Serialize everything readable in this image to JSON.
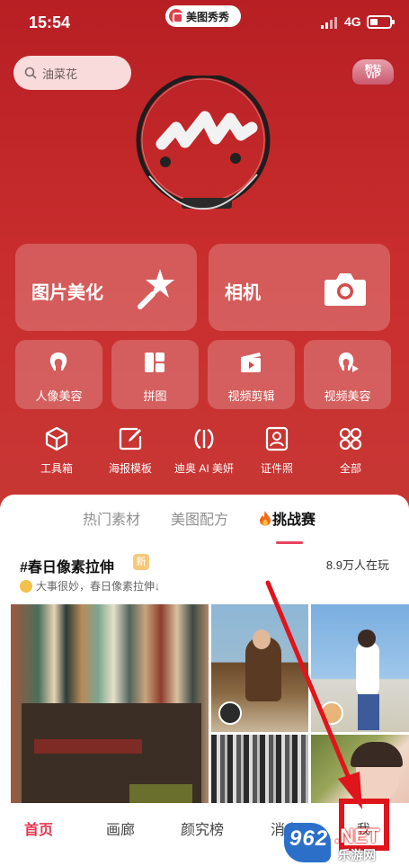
{
  "status_bar": {
    "time": "15:54",
    "network": "4G",
    "app_pill": "美图秀秀"
  },
  "search": {
    "placeholder": "油菜花"
  },
  "vip": {
    "line1": "粉钻",
    "line2": "VIP"
  },
  "main_cards": [
    {
      "label": "图片美化",
      "icon": "magic-wand-icon"
    },
    {
      "label": "相机",
      "icon": "camera-icon"
    }
  ],
  "feature_cards": [
    {
      "label": "人像美容",
      "icon": "portrait-icon"
    },
    {
      "label": "拼图",
      "icon": "collage-icon"
    },
    {
      "label": "视频剪辑",
      "icon": "video-clip-icon"
    },
    {
      "label": "视频美容",
      "icon": "video-beauty-icon"
    }
  ],
  "tools": [
    {
      "label": "工具箱",
      "icon": "toolbox-icon"
    },
    {
      "label": "海报模板",
      "icon": "poster-icon"
    },
    {
      "label": "迪奥 AI 美妍",
      "icon": "dior-icon"
    },
    {
      "label": "证件照",
      "icon": "id-photo-icon"
    },
    {
      "label": "全部",
      "icon": "grid-icon"
    }
  ],
  "content_tabs": [
    {
      "label": "热门素材",
      "active": false
    },
    {
      "label": "美图配方",
      "active": false
    },
    {
      "label": "挑战赛",
      "active": true,
      "icon": "fire-icon"
    }
  ],
  "challenge": {
    "title": "#春日像素拉伸",
    "badge": "新",
    "online_count": "8.9万人在玩",
    "subtitle": "大事很妙，春日像素拉伸↓"
  },
  "bottom_nav": [
    {
      "label": "首页",
      "active": true
    },
    {
      "label": "画廊",
      "active": false
    },
    {
      "label": "颜究榜",
      "active": false
    },
    {
      "label": "消息",
      "active": false
    },
    {
      "label": "我",
      "active": false
    }
  ],
  "watermark": {
    "brand": "962",
    "suffix": ".NET",
    "text": "乐游网"
  },
  "colors": {
    "brand_red": "#c42a2a",
    "accent": "#e6364e",
    "highlight": "#e0141b"
  }
}
